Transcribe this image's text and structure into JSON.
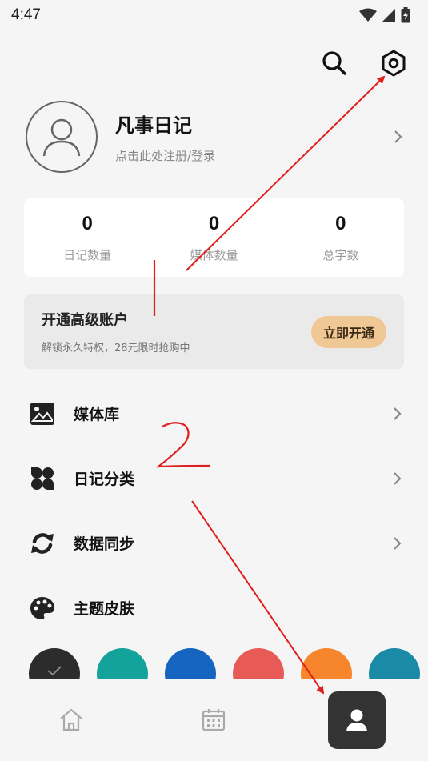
{
  "status_bar": {
    "time": "4:47"
  },
  "header": {
    "search_icon": "search-icon",
    "settings_icon": "gear-icon"
  },
  "profile": {
    "name": "凡事日记",
    "subtitle": "点击此处注册/登录"
  },
  "stats": [
    {
      "value": "0",
      "label": "日记数量"
    },
    {
      "value": "0",
      "label": "媒体数量"
    },
    {
      "value": "0",
      "label": "总字数"
    }
  ],
  "premium": {
    "title": "开通高级账户",
    "subtitle": "解锁永久特权，28元限时抢购中",
    "button_label": "立即开通"
  },
  "menu": [
    {
      "label": "媒体库",
      "icon": "image-icon"
    },
    {
      "label": "日记分类",
      "icon": "grid-icon"
    },
    {
      "label": "数据同步",
      "icon": "sync-icon"
    },
    {
      "label": "主题皮肤",
      "icon": "palette-icon"
    }
  ],
  "theme_colors": [
    "#2c2c2c",
    "#14a39a",
    "#1565c0",
    "#e85a55",
    "#f7852c",
    "#1a8aa6"
  ],
  "bottom_nav": [
    {
      "name": "home",
      "icon": "home-icon"
    },
    {
      "name": "calendar",
      "icon": "calendar-icon"
    },
    {
      "name": "profile",
      "icon": "user-icon",
      "active": true
    }
  ],
  "annotation": {
    "number": "2",
    "color": "#e01e1e"
  }
}
